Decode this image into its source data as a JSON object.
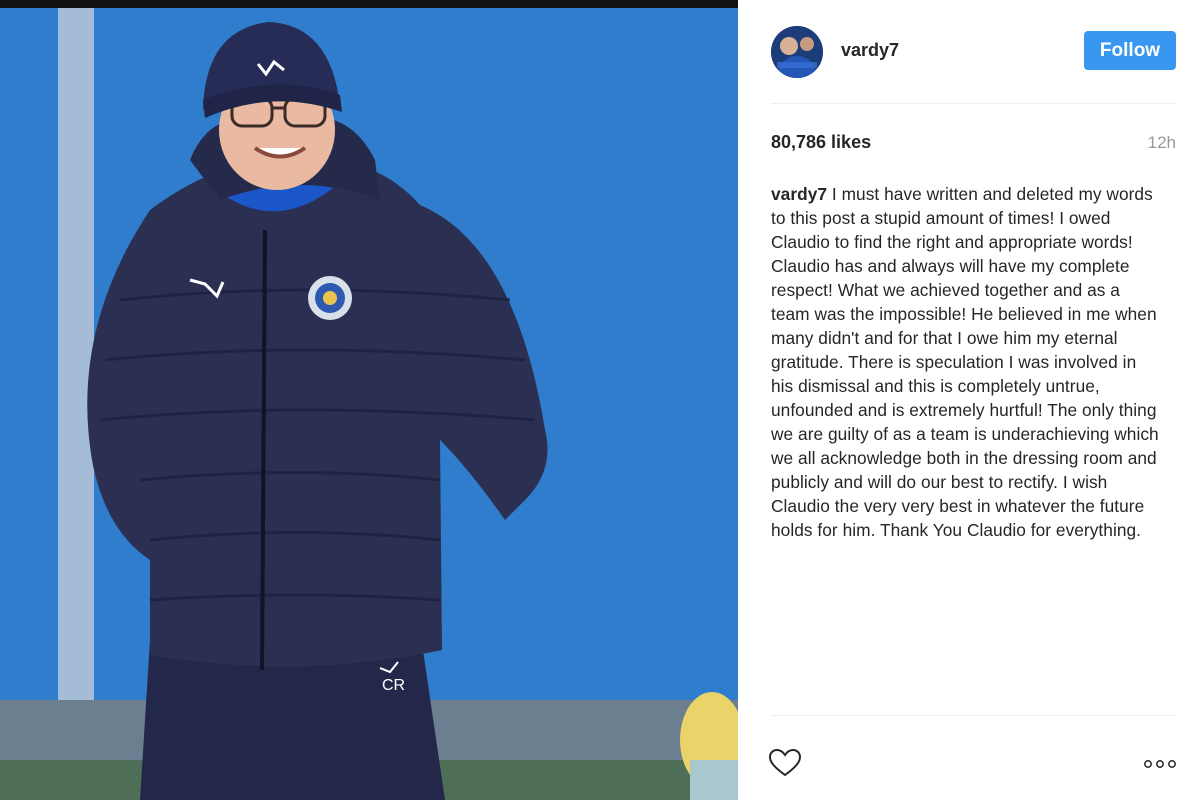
{
  "post": {
    "username": "vardy7",
    "follow_label": "Follow",
    "likes": "80,786 likes",
    "timestamp": "12h",
    "caption_user": "vardy7",
    "caption_text": " I must have written and deleted my words to this post a stupid amount of times! I owed Claudio to find the right and appropriate words! Claudio has and always will have my complete respect! What we achieved together and as a team was the impossible! He believed in me when many didn't and for that I owe him my eternal gratitude. There is speculation I was involved in his dismissal and this is completely untrue, unfounded and is extremely hurtful! The only thing we are guilty of as a team is underachieving which we all acknowledge both in the dressing room and publicly and will do our best to rectify. I wish Claudio the very very best in whatever the future holds for him. Thank You Claudio for everything."
  },
  "icons": {
    "like": "heart-icon",
    "more": "more-options-icon"
  },
  "colors": {
    "follow_button": "#3897f0",
    "photo_background": "#2f78c5",
    "jacket": "#2b2f52"
  }
}
